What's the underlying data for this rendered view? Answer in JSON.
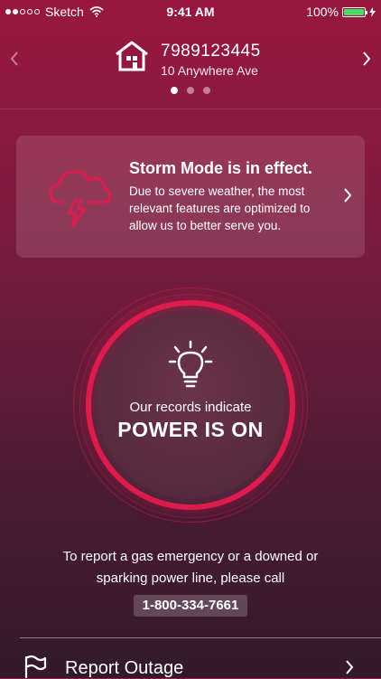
{
  "status_bar": {
    "carrier": "Sketch",
    "time": "9:41 AM",
    "battery": "100%"
  },
  "account": {
    "number": "7989123445",
    "address": "10 Anywhere Ave",
    "pages": 3,
    "current_page": 1
  },
  "storm": {
    "title": "Storm Mode is in effect.",
    "body": "Due to severe weather, the most relevant features are optimized to allow us to better serve you."
  },
  "power_status": {
    "line1": "Our records indicate",
    "line2": "POWER IS ON"
  },
  "emergency": {
    "text_line1": "To report a gas emergency or a downed or",
    "text_line2": "sparking power line, please call",
    "phone": "1-800-334-7661"
  },
  "menu": {
    "report_outage": "Report Outage"
  },
  "colors": {
    "accent": "#de1b4d",
    "battery": "#4cd964"
  }
}
